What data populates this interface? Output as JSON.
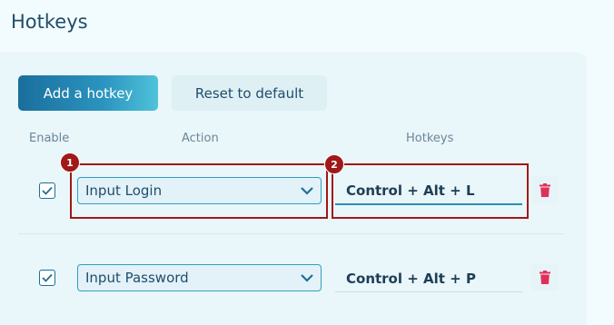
{
  "page": {
    "title": "Hotkeys"
  },
  "toolbar": {
    "add_label": "Add a hotkey",
    "reset_label": "Reset to default"
  },
  "columns": {
    "enable": "Enable",
    "action": "Action",
    "hotkeys": "Hotkeys"
  },
  "rows": [
    {
      "enabled": true,
      "action": "Input Login",
      "hotkey": "Control + Alt + L"
    },
    {
      "enabled": true,
      "action": "Input Password",
      "hotkey": "Control + Alt + P"
    }
  ],
  "annotations": [
    {
      "number": "1",
      "target": "action-select-row-1"
    },
    {
      "number": "2",
      "target": "hotkey-field-row-1"
    }
  ],
  "colors": {
    "accent": "#2b93bf",
    "highlight": "#a01818",
    "danger": "#e0305a"
  }
}
